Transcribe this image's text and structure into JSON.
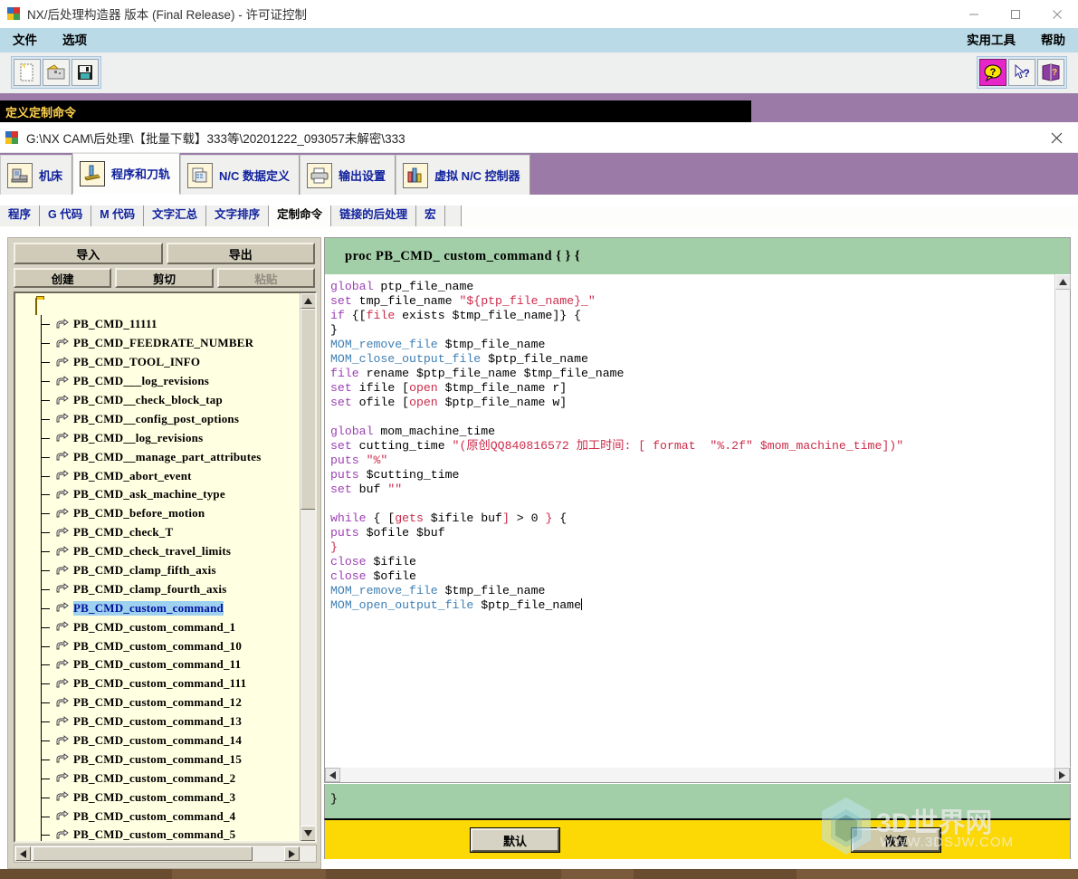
{
  "window": {
    "title": "NX/后处理构造器 版本 (Final Release) - 许可证控制",
    "minimize": "–",
    "maximize": "□",
    "close": "✕"
  },
  "menu": {
    "left": [
      {
        "label": "文件",
        "name": "menu-file"
      },
      {
        "label": "选项",
        "name": "menu-options"
      }
    ],
    "right": [
      {
        "label": "实用工具",
        "name": "menu-utilities"
      },
      {
        "label": "帮助",
        "name": "menu-help"
      }
    ]
  },
  "toolbar": {
    "left": [
      {
        "name": "new-icon",
        "title": "新建"
      },
      {
        "name": "open-icon",
        "title": "打开"
      },
      {
        "name": "save-icon",
        "title": "保存"
      }
    ],
    "right": [
      {
        "name": "help-balloon-icon",
        "title": "帮助气泡"
      },
      {
        "name": "context-help-icon",
        "title": "上下文帮助"
      },
      {
        "name": "manual-book-icon",
        "title": "手册"
      }
    ]
  },
  "define_bar": {
    "label": "定义定制命令"
  },
  "path_bar": {
    "path": "G:\\NX CAM\\后处理\\【批量下载】333等\\20201222_093057未解密\\333",
    "close": "✕"
  },
  "big_tabs": [
    {
      "label": "机床",
      "name": "tab-machine-tool",
      "icon": "machine-icon",
      "active": false
    },
    {
      "label": "程序和刀轨",
      "name": "tab-program-toolpath",
      "icon": "toolpath-icon",
      "active": true
    },
    {
      "label": "N/C 数据定义",
      "name": "tab-nc-data-definitions",
      "icon": "nc-data-icon",
      "active": false
    },
    {
      "label": "输出设置",
      "name": "tab-output-settings",
      "icon": "printer-icon",
      "active": false
    },
    {
      "label": "虚拟 N/C 控制器",
      "name": "tab-virtual-nc-controller",
      "icon": "controller-icon",
      "active": false
    }
  ],
  "sub_tabs": [
    {
      "label": "程序",
      "name": "subtab-program",
      "active": false
    },
    {
      "label": "G 代码",
      "name": "subtab-g-code",
      "active": false
    },
    {
      "label": "M 代码",
      "name": "subtab-m-code",
      "active": false
    },
    {
      "label": "文字汇总",
      "name": "subtab-word-summary",
      "active": false
    },
    {
      "label": "文字排序",
      "name": "subtab-word-sequencing",
      "active": false
    },
    {
      "label": "定制命令",
      "name": "subtab-custom-command",
      "active": true
    },
    {
      "label": "链接的后处理",
      "name": "subtab-linked-post",
      "active": false
    },
    {
      "label": "宏",
      "name": "subtab-macro",
      "active": false
    }
  ],
  "left_panel": {
    "buttons_row1": [
      {
        "label": "导入",
        "name": "import-button",
        "disabled": false
      },
      {
        "label": "导出",
        "name": "export-button",
        "disabled": false
      }
    ],
    "buttons_row2": [
      {
        "label": "创建",
        "name": "create-button",
        "disabled": false
      },
      {
        "label": "剪切",
        "name": "cut-button",
        "disabled": false
      },
      {
        "label": "粘贴",
        "name": "paste-button",
        "disabled": true
      }
    ],
    "tree_items": [
      "PB_CMD_11111",
      "PB_CMD_FEEDRATE_NUMBER",
      "PB_CMD_TOOL_INFO",
      "PB_CMD___log_revisions",
      "PB_CMD__check_block_tap",
      "PB_CMD__config_post_options",
      "PB_CMD__log_revisions",
      "PB_CMD__manage_part_attributes",
      "PB_CMD_abort_event",
      "PB_CMD_ask_machine_type",
      "PB_CMD_before_motion",
      "PB_CMD_check_T",
      "PB_CMD_check_travel_limits",
      "PB_CMD_clamp_fifth_axis",
      "PB_CMD_clamp_fourth_axis",
      "PB_CMD_custom_command",
      "PB_CMD_custom_command_1",
      "PB_CMD_custom_command_10",
      "PB_CMD_custom_command_11",
      "PB_CMD_custom_command_111",
      "PB_CMD_custom_command_12",
      "PB_CMD_custom_command_13",
      "PB_CMD_custom_command_14",
      "PB_CMD_custom_command_15",
      "PB_CMD_custom_command_2",
      "PB_CMD_custom_command_3",
      "PB_CMD_custom_command_4",
      "PB_CMD_custom_command_5"
    ],
    "selected_item": "PB_CMD_custom_command"
  },
  "editor": {
    "proc_header": "proc    PB_CMD_ custom_command   { }   {",
    "footer": "}",
    "code_lines": [
      [
        {
          "t": "global",
          "c": "kw"
        },
        {
          "t": " ptp_file_name",
          "c": ""
        }
      ],
      [
        {
          "t": "set",
          "c": "kw"
        },
        {
          "t": " tmp_file_name ",
          "c": ""
        },
        {
          "t": "\"${ptp_file_name}_\"",
          "c": "arg"
        }
      ],
      [
        {
          "t": "if",
          "c": "kw"
        },
        {
          "t": " {[",
          "c": ""
        },
        {
          "t": "file",
          "c": "arg"
        },
        {
          "t": " exists $tmp_file_name]} {",
          "c": ""
        }
      ],
      [
        {
          "t": "}",
          "c": ""
        }
      ],
      [
        {
          "t": "MOM_remove_file",
          "c": "mom"
        },
        {
          "t": " $tmp_file_name",
          "c": ""
        }
      ],
      [
        {
          "t": "MOM_close_output_file",
          "c": "mom"
        },
        {
          "t": " $ptp_file_name",
          "c": ""
        }
      ],
      [
        {
          "t": "file",
          "c": "kw"
        },
        {
          "t": " rename $ptp_file_name $tmp_file_name",
          "c": ""
        }
      ],
      [
        {
          "t": "set",
          "c": "kw"
        },
        {
          "t": " ifile [",
          "c": ""
        },
        {
          "t": "open",
          "c": "arg"
        },
        {
          "t": " $tmp_file_name r]",
          "c": ""
        }
      ],
      [
        {
          "t": "set",
          "c": "kw"
        },
        {
          "t": " ofile [",
          "c": ""
        },
        {
          "t": "open",
          "c": "arg"
        },
        {
          "t": " $ptp_file_name w]",
          "c": ""
        }
      ],
      [
        {
          "t": "",
          "c": ""
        }
      ],
      [
        {
          "t": "global",
          "c": "kw"
        },
        {
          "t": " mom_machine_time",
          "c": ""
        }
      ],
      [
        {
          "t": "set",
          "c": "kw"
        },
        {
          "t": " cutting_time ",
          "c": ""
        },
        {
          "t": "\"(原创QQ840816572 加工时间: [ format  \"%.2f\" $mom_machine_time])\"",
          "c": "arg"
        }
      ],
      [
        {
          "t": "puts",
          "c": "kw"
        },
        {
          "t": " ",
          "c": ""
        },
        {
          "t": "\"%\"",
          "c": "arg"
        }
      ],
      [
        {
          "t": "puts",
          "c": "kw"
        },
        {
          "t": " $cutting_time",
          "c": ""
        }
      ],
      [
        {
          "t": "set",
          "c": "kw"
        },
        {
          "t": " buf ",
          "c": ""
        },
        {
          "t": "\"\"",
          "c": "arg"
        }
      ],
      [
        {
          "t": "",
          "c": ""
        }
      ],
      [
        {
          "t": "while",
          "c": "kw"
        },
        {
          "t": " { [",
          "c": ""
        },
        {
          "t": "gets",
          "c": "arg"
        },
        {
          "t": " $ifile buf",
          "c": ""
        },
        {
          "t": "]",
          "c": "arg"
        },
        {
          "t": " > 0 ",
          "c": ""
        },
        {
          "t": "}",
          "c": "arg"
        },
        {
          "t": " {",
          "c": ""
        }
      ],
      [
        {
          "t": "puts",
          "c": "kw"
        },
        {
          "t": " $ofile $buf",
          "c": ""
        }
      ],
      [
        {
          "t": "}",
          "c": "arg"
        }
      ],
      [
        {
          "t": "close",
          "c": "kw"
        },
        {
          "t": " $ifile",
          "c": ""
        }
      ],
      [
        {
          "t": "close",
          "c": "kw"
        },
        {
          "t": " $ofile",
          "c": ""
        }
      ],
      [
        {
          "t": "MOM_remove_file",
          "c": "mom"
        },
        {
          "t": " $tmp_file_name",
          "c": ""
        }
      ],
      [
        {
          "t": "MOM_open_output_file",
          "c": "mom"
        },
        {
          "t": " $ptp_file_name",
          "c": ""
        }
      ]
    ]
  },
  "footer_buttons": [
    {
      "label": "默认",
      "name": "default-button"
    },
    {
      "label": "恢复",
      "name": "restore-button"
    }
  ],
  "watermark": {
    "title": "3D世界网",
    "url": "WWW.3DSJW.COM"
  },
  "colors": {
    "menubar": "#b9dae6",
    "purple": "#9b7aa8",
    "define_bar_bg": "#000000",
    "define_bar_fg": "#ffd24d",
    "panel": "#d6d3c4",
    "tree_bg": "#ffffe1",
    "selection": "#9ed0ef",
    "green_header": "#a3cfa8",
    "yellow_bar": "#fcd804",
    "tab_text": "#12239e",
    "kw": "#9c3fb4",
    "arg": "#cc2b4a",
    "mom": "#3f7fb4"
  }
}
